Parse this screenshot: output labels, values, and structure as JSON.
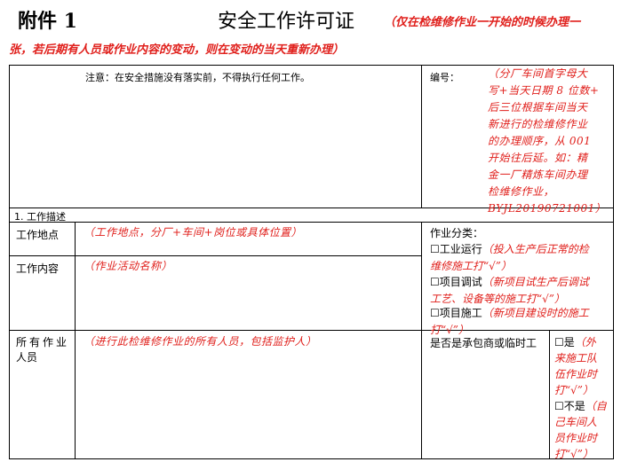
{
  "header": {
    "attachment": "附件 1",
    "title": "安全工作许可证",
    "note_line1": "（仅在检维修作业一开始的时候办理一",
    "note_line2": "张，若后期有人员或作业内容的变动，则在变动的当天重新办理）"
  },
  "top": {
    "notice": "注意：在安全措施没有落实前，不得执行任何工作。",
    "number_label": "编号：",
    "number_hint": [
      "（分厂车间首字母大",
      "写+当天日期 8 位数+",
      "后三位根据车间当天",
      "新进行的检维修作业",
      "的办理顺序，从 001",
      "开始往后延。如：精",
      "金一厂精炼车间办理",
      "检维修作业，",
      "BYJL20190721001）"
    ]
  },
  "section1": {
    "title": "1. 工作描述",
    "location_label": "工作地点",
    "location_hint": "（工作地点，分厂+车间+岗位或具体位置）",
    "content_label": "工作内容",
    "content_hint": "（作业活动名称）",
    "category_label": "作业分类：",
    "categories": [
      {
        "mark": "☐工业运行",
        "hint_a": "（投入生产后正常的检",
        "hint_b": "维修施工打“√”）"
      },
      {
        "mark": "☐项目调试",
        "hint_a": "（新项目试生产后调试",
        "hint_b": "工艺、设备等的施工打“√”）"
      },
      {
        "mark": "☐项目施工",
        "hint_a": "（新项目建设时的施工",
        "hint_b": "打“√”）"
      }
    ],
    "personnel_label_a": "所有作业",
    "personnel_label_b": "人员",
    "personnel_hint": "（进行此检维修作业的所有人员，包括监护人）",
    "contractor_label": "是否是承包商或临时工",
    "yes_mark": "☐是",
    "yes_hint": [
      "（外",
      "来施工队",
      "伍作业时",
      "打“√”）"
    ],
    "no_mark": "☐不是",
    "no_hint": [
      "（自",
      "己车间人",
      "员作业时",
      "打“√”）"
    ]
  }
}
